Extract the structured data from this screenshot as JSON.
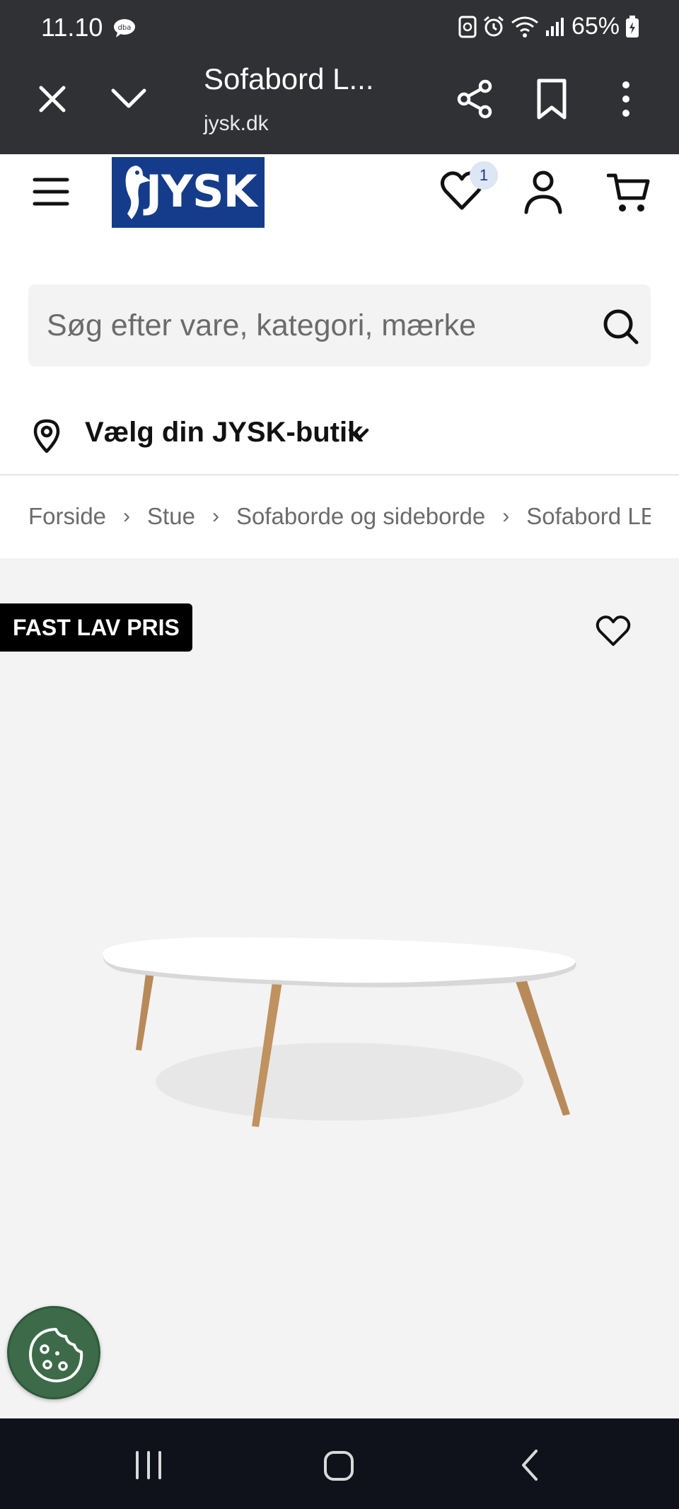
{
  "status_bar": {
    "time": "11.10",
    "app_icon": "dba-chat-icon",
    "battery": "65%"
  },
  "browser": {
    "title": "Sofabord L...",
    "url": "jysk.dk",
    "icons": [
      "close-icon",
      "chevron-down-icon",
      "share-icon",
      "bookmark-icon",
      "more-vert-icon"
    ]
  },
  "header": {
    "logo_text": "JYSK",
    "wishlist_count": "1",
    "brand_color": "#143c8a"
  },
  "search": {
    "placeholder": "Søg efter vare, kategori, mærke"
  },
  "store_selector": {
    "label": "Vælg din JYSK-butik"
  },
  "breadcrumb": {
    "items": [
      "Forside",
      "Stue",
      "Sofaborde og sideborde",
      "Sofabord LE"
    ]
  },
  "product": {
    "badge": "FAST LAV PRIS"
  }
}
